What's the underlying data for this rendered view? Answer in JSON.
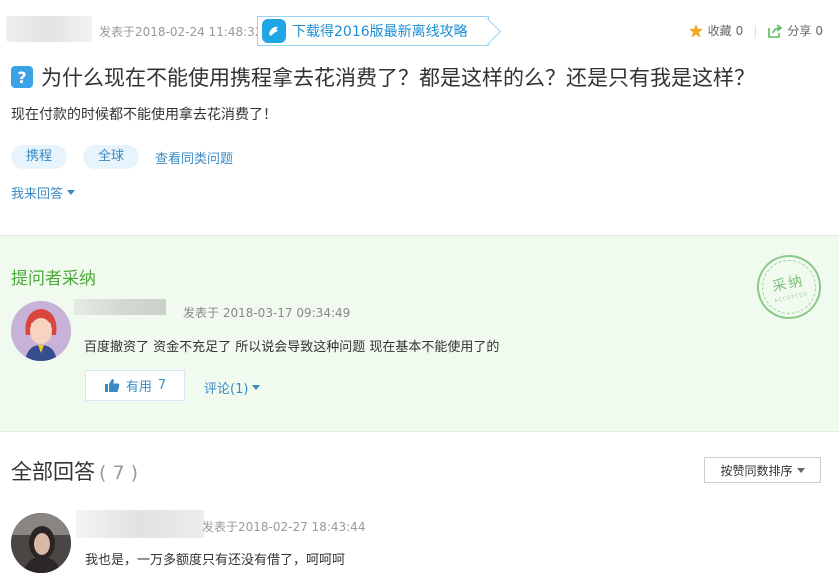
{
  "question": {
    "post_time": "发表于2018-02-24 11:48:32",
    "download_banner": "下载得2016版最新离线攻略",
    "favorite_label": "收藏",
    "favorite_count": "0",
    "share_label": "分享",
    "share_count": "0",
    "icon_glyph": "?",
    "title": "为什么现在不能使用携程拿去花消费了？都是这样的么？还是只有我是这样？",
    "description": "现在付款的时候都不能使用拿去花消费了！",
    "tags": [
      "携程",
      "全球"
    ],
    "similar_link": "查看同类问题",
    "answer_me": "我来回答"
  },
  "accepted_answer": {
    "section_title": "提问者采纳",
    "time": "发表于 2018-03-17 09:34:49",
    "content": "百度撤资了  资金不充足了  所以说会导致这种问题  现在基本不能使用了的",
    "useful_label": "有用",
    "useful_count": "7",
    "comment_label": "评论(1)",
    "stamp_text": "采纳",
    "stamp_sub": "ACCEPTED"
  },
  "all_answers": {
    "title": "全部回答",
    "count": "( 7 )",
    "sort_label": "按赞同数排序",
    "items": [
      {
        "time": "发表于2018-02-27 18:43:44",
        "content": "我也是，一万多额度只有还没有借了，呵呵呵"
      }
    ]
  },
  "colors": {
    "link": "#3a8bc4",
    "accepted_bg": "#f0faef",
    "accepted_title": "#4caa3a",
    "banner": "#1a8ed4",
    "star": "#f5a623",
    "share": "#5cb85c"
  },
  "icons": [
    "star-icon",
    "share-icon",
    "question-icon",
    "thumb-up-icon",
    "chevron-down-icon",
    "dolphin-logo-icon"
  ]
}
